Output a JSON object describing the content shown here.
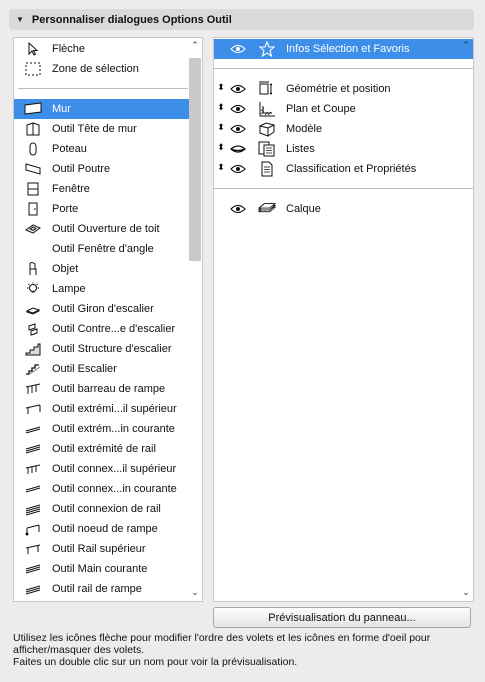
{
  "header": {
    "title": "Personnaliser dialogues Options Outil"
  },
  "left_list": {
    "top_items": [
      {
        "label": "Flèche",
        "icon": "arrow-pointer-icon"
      },
      {
        "label": "Zone de sélection",
        "icon": "marquee-icon"
      }
    ],
    "items": [
      {
        "label": "Mur",
        "icon": "wall-icon",
        "selected": true
      },
      {
        "label": "Outil Tête de mur",
        "icon": "wall-end-icon"
      },
      {
        "label": "Poteau",
        "icon": "column-icon"
      },
      {
        "label": "Outil Poutre",
        "icon": "beam-icon"
      },
      {
        "label": "Fenêtre",
        "icon": "window-icon"
      },
      {
        "label": "Porte",
        "icon": "door-icon"
      },
      {
        "label": "Outil Ouverture de toit",
        "icon": "skylight-icon"
      },
      {
        "label": "Outil Fenêtre d'angle",
        "icon": ""
      },
      {
        "label": "Objet",
        "icon": "chair-object-icon"
      },
      {
        "label": "Lampe",
        "icon": "lamp-icon"
      },
      {
        "label": "Outil Giron d'escalier",
        "icon": "stair-tread-icon"
      },
      {
        "label": "Outil Contre...e d'escalier",
        "icon": "stair-riser-icon"
      },
      {
        "label": "Outil Structure d'escalier",
        "icon": "stair-structure-icon"
      },
      {
        "label": "Outil Escalier",
        "icon": "stair-icon"
      },
      {
        "label": "Outil barreau de rampe",
        "icon": "railing-baluster-icon"
      },
      {
        "label": "Outil extrémi...il supérieur",
        "icon": "railing-top-end-icon"
      },
      {
        "label": "Outil extrém...in courante",
        "icon": "handrail-end-icon"
      },
      {
        "label": "Outil extrémité de rail",
        "icon": "rail-end-icon"
      },
      {
        "label": "Outil connex...il supérieur",
        "icon": "top-rail-connection-icon"
      },
      {
        "label": "Outil connex...in courante",
        "icon": "handrail-connection-icon"
      },
      {
        "label": "Outil connexion de rail",
        "icon": "rail-connection-icon"
      },
      {
        "label": "Outil noeud de rampe",
        "icon": "railing-node-icon"
      },
      {
        "label": "Outil Rail supérieur",
        "icon": "top-rail-icon"
      },
      {
        "label": "Outil Main courante",
        "icon": "handrail-icon"
      },
      {
        "label": "Outil rail de rampe",
        "icon": "railing-rail-icon"
      }
    ]
  },
  "right_list": {
    "favorites": {
      "label": "Infos Sélection et Favoris",
      "icon": "star-icon",
      "selected": true
    },
    "panels": [
      {
        "label": "Géométrie et position",
        "icon": "geometry-icon",
        "eye": "open"
      },
      {
        "label": "Plan et Coupe",
        "icon": "plan-section-icon",
        "eye": "open"
      },
      {
        "label": "Modèle",
        "icon": "model-box-icon",
        "eye": "open"
      },
      {
        "label": "Listes",
        "icon": "listing-icon",
        "eye": "closed"
      },
      {
        "label": "Classification et Propriétés",
        "icon": "properties-icon",
        "eye": "open"
      }
    ],
    "layer": {
      "label": "Calque",
      "icon": "layer-icon"
    }
  },
  "preview_button": {
    "label": "Prévisualisation du panneau..."
  },
  "help": {
    "line1": "Utilisez les icônes flèche pour modifier l'ordre des volets et les icônes en forme d'oeil pour afficher/masquer des volets.",
    "line2": "Faites un double clic sur un nom pour voir la prévisualisation."
  },
  "colors": {
    "selection": "#3d8ee8",
    "background": "#ececec",
    "header": "#d9d9d9"
  }
}
